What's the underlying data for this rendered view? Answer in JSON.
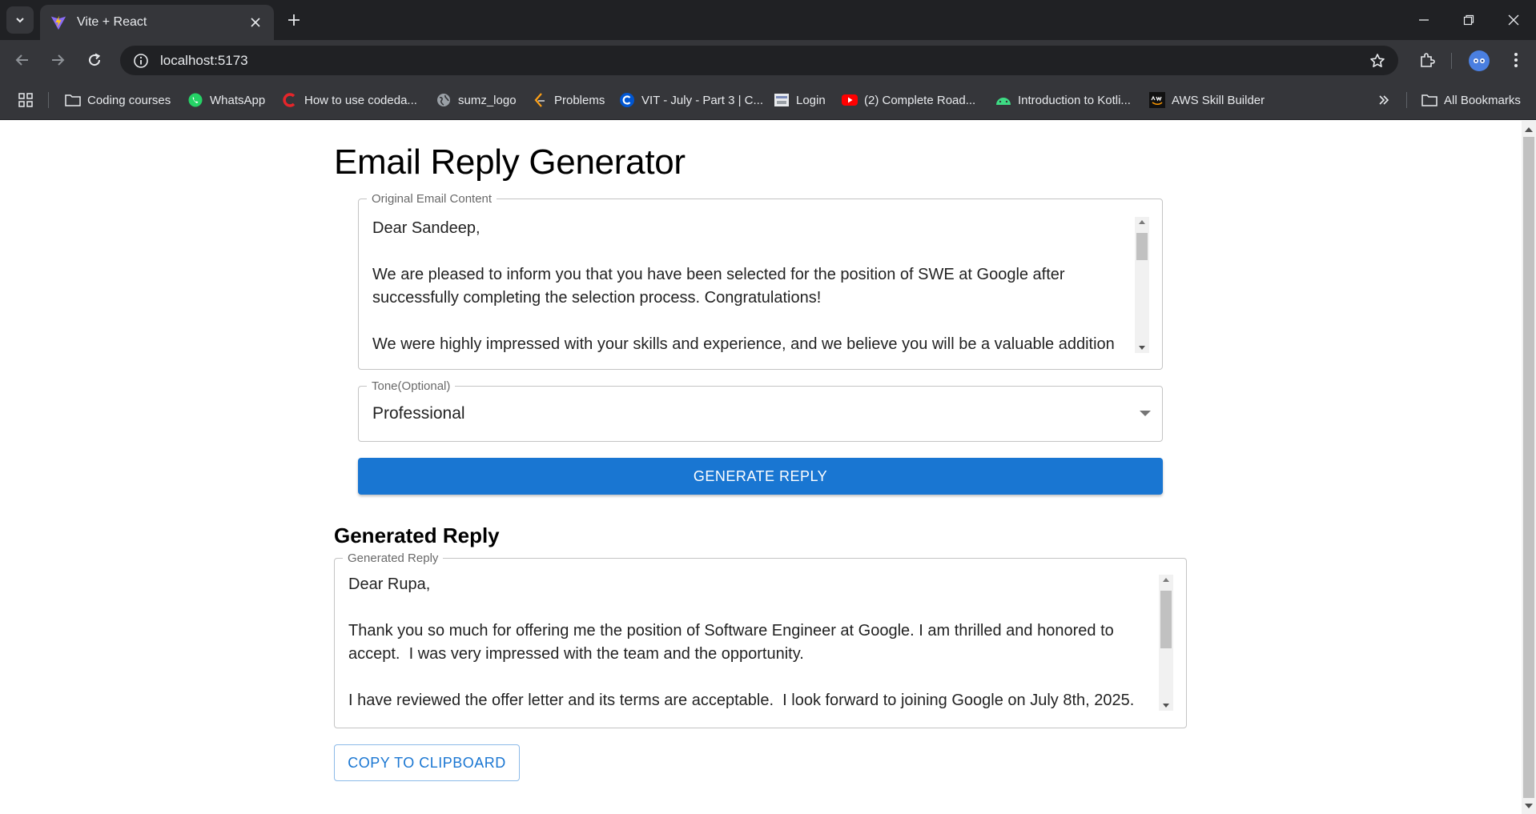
{
  "browser": {
    "tab_title": "Vite + React",
    "url": "localhost:5173",
    "bookmarks": [
      {
        "label": "Coding courses",
        "icon": "folder-icon"
      },
      {
        "label": "WhatsApp",
        "icon": "whatsapp-icon"
      },
      {
        "label": "How to use codeda...",
        "icon": "codedamn-icon"
      },
      {
        "label": "sumz_logo",
        "icon": "globe-icon"
      },
      {
        "label": "Problems",
        "icon": "leetcode-icon"
      },
      {
        "label": "VIT - July - Part 3 | C...",
        "icon": "coursera-icon"
      },
      {
        "label": "Login",
        "icon": "login-icon"
      },
      {
        "label": "(2) Complete Road...",
        "icon": "youtube-icon"
      },
      {
        "label": "Introduction to Kotli...",
        "icon": "android-icon"
      },
      {
        "label": "AWS Skill Builder",
        "icon": "aws-icon"
      }
    ],
    "all_bookmarks": "All Bookmarks",
    "colors": {
      "chrome_dark": "#202124",
      "chrome": "#35363a",
      "text": "#e8eaed"
    }
  },
  "app": {
    "title": "Email Reply Generator",
    "email_field": {
      "label": "Original Email Content",
      "value": "Dear Sandeep,\n\nWe are pleased to inform you that you have been selected for the position of SWE at Google after successfully completing the selection process. Congratulations!\n\nWe were highly impressed with your skills and experience, and we believe you will be a valuable addition"
    },
    "tone_field": {
      "label": "Tone(Optional)",
      "value": "Professional"
    },
    "generate_button": "GENERATE REPLY",
    "reply_section_title": "Generated Reply",
    "reply_field": {
      "label": "Generated Reply",
      "value": "Dear Rupa,\n\nThank you so much for offering me the position of Software Engineer at Google. I am thrilled and honored to accept.  I was very impressed with the team and the opportunity.\n\nI have reviewed the offer letter and its terms are acceptable.  I look forward to joining Google on July 8th, 2025."
    },
    "copy_button": "COPY TO CLIPBOARD",
    "colors": {
      "primary": "#1976d2",
      "border": "#c4c4c4"
    }
  }
}
